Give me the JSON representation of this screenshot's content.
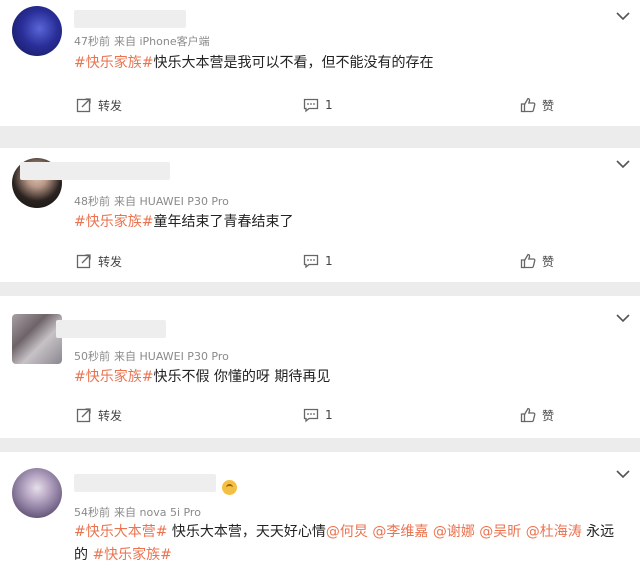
{
  "comments": [
    {
      "time": "47秒前",
      "source": "来自 iPhone客户端",
      "text_segments": [
        {
          "text": "#快乐家族#",
          "kind": "tag"
        },
        {
          "text": "快乐大本营是我可以不看，但不能没有的存在",
          "kind": "plain"
        }
      ],
      "repost_label": "转发",
      "comment_count": "1",
      "like_label": "赞"
    },
    {
      "time": "48秒前",
      "source": "来自 HUAWEI P30 Pro",
      "text_segments": [
        {
          "text": "#快乐家族#",
          "kind": "tag"
        },
        {
          "text": "童年结束了青春结束了",
          "kind": "plain"
        }
      ],
      "repost_label": "转发",
      "comment_count": "1",
      "like_label": "赞"
    },
    {
      "time": "50秒前",
      "source": "来自 HUAWEI P30 Pro",
      "text_segments": [
        {
          "text": "#快乐家族#",
          "kind": "tag"
        },
        {
          "text": "快乐不假 你懂的呀 期待再见",
          "kind": "plain"
        }
      ],
      "repost_label": "转发",
      "comment_count": "1",
      "like_label": "赞"
    },
    {
      "time": "54秒前",
      "source": "来自 nova 5i Pro",
      "line1_segments": [
        {
          "text": "#快乐大本营#",
          "kind": "tag"
        },
        {
          "text": " 快乐大本营，天天好心情",
          "kind": "plain"
        },
        {
          "text": "@何炅",
          "kind": "mention"
        },
        {
          "text": " ",
          "kind": "plain"
        },
        {
          "text": "@李维嘉",
          "kind": "mention"
        },
        {
          "text": " ",
          "kind": "plain"
        },
        {
          "text": "@谢娜",
          "kind": "mention"
        },
        {
          "text": " ",
          "kind": "plain"
        },
        {
          "text": "@吴昕",
          "kind": "mention"
        },
        {
          "text": " ",
          "kind": "plain"
        },
        {
          "text": "@杜海涛",
          "kind": "mention"
        },
        {
          "text": " 永远",
          "kind": "plain"
        }
      ],
      "line2_segments": [
        {
          "text": "的 ",
          "kind": "plain"
        },
        {
          "text": "#快乐家族#",
          "kind": "tag"
        }
      ]
    }
  ],
  "colors": {
    "link": "#eb7350",
    "meta": "#8a8a8a",
    "separator": "#ececec"
  }
}
